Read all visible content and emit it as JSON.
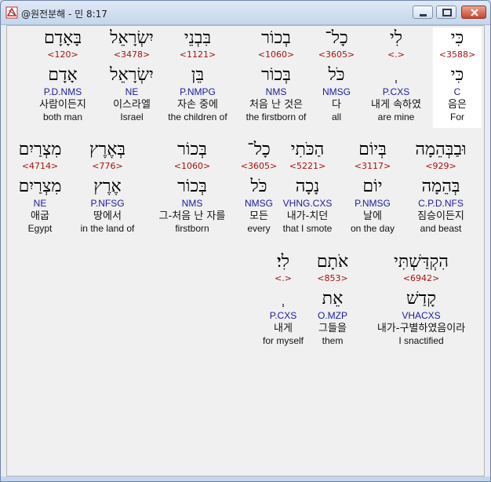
{
  "window": {
    "title": "@원전분해 - 민 8:17",
    "buttons": {
      "minimize": "minimize-icon",
      "maximize": "maximize-icon",
      "close": "close-icon"
    }
  },
  "verse": {
    "rows": [
      {
        "words": [
          {
            "heb": "כִּי",
            "strong": "<3588>",
            "lemma": "כִּי",
            "parse": "C",
            "kor": "음은",
            "eng": "For",
            "selected": true
          },
          {
            "heb": "לִי",
            "strong": "<.>",
            "lemma": "ְ",
            "parse": "P.CXS",
            "kor": "내게 속하였",
            "eng": "are mine"
          },
          {
            "heb": "כָל־",
            "strong": "<3605>",
            "lemma": "כֹּל",
            "parse": "NMSG",
            "kor": "다",
            "eng": "all"
          },
          {
            "heb": "בְכוֹר",
            "strong": "<1060>",
            "lemma": "בְּכוֹר",
            "parse": "NMS",
            "kor": "처음 난 것은",
            "eng": "the firstborn of"
          },
          {
            "heb": "בִּבְנֵי",
            "strong": "<1121>",
            "lemma": "בֵּן",
            "parse": "P.NMPG",
            "kor": "자손 중에",
            "eng": "the children of"
          },
          {
            "heb": "יִשְׂרָאֵל",
            "strong": "<3478>",
            "lemma": "יִשְׂרָאֵל",
            "parse": "NE",
            "kor": "이스라엘",
            "eng": "Israel"
          },
          {
            "heb": "בָּאָדָם",
            "strong": "<120>",
            "lemma": "אָדָם",
            "parse": "P.D.NMS",
            "kor": "사람이든지",
            "eng": "both man"
          }
        ]
      },
      {
        "words": [
          {
            "heb": "וּבַבְּהֵמָה",
            "strong": "<929>",
            "lemma": "בְּהֵמָה",
            "parse": "C.P.D.NFS",
            "kor": "짐승이든지",
            "eng": "and beast"
          },
          {
            "heb": "בְּיוֹם",
            "strong": "<3117>",
            "lemma": "יוֹם",
            "parse": "P.NMSG",
            "kor": "날에",
            "eng": "on the day"
          },
          {
            "heb": "הַכֹּתִי",
            "strong": "<5221>",
            "lemma": "נָכָה",
            "parse": "VHNG.CXS",
            "kor": "내가-치던",
            "eng": "that I smote"
          },
          {
            "heb": "כָל־",
            "strong": "<3605>",
            "lemma": "כֹּל",
            "parse": "NMSG",
            "kor": "모든",
            "eng": "every"
          },
          {
            "heb": "בְּכוֹר",
            "strong": "<1060>",
            "lemma": "בְּכוֹר",
            "parse": "NMS",
            "kor": "그-처음 난 자를",
            "eng": "firstborn"
          },
          {
            "heb": "בְּאֶרֶץ",
            "strong": "<776>",
            "lemma": "אֶרֶץ",
            "parse": "P.NFSG",
            "kor": "땅에서",
            "eng": "in the land of"
          },
          {
            "heb": "מִצְרַיִם",
            "strong": "<4714>",
            "lemma": "מִצְרַיִם",
            "parse": "NE",
            "kor": "애굽",
            "eng": "Egypt"
          }
        ]
      },
      {
        "words": [
          {
            "heb": "הִקְדַּשְׁתִּי",
            "strong": "<6942>",
            "lemma": "קָדַשׁ",
            "parse": "VHACXS",
            "kor": "내가-구별하였음이라",
            "eng": "I snactified"
          },
          {
            "heb": "אֹתָם",
            "strong": "<853>",
            "lemma": "אֵת",
            "parse": "O.MZP",
            "kor": "그들을",
            "eng": "them"
          },
          {
            "heb": "לִי׃",
            "strong": "<.>",
            "lemma": "ְ",
            "parse": "P.CXS",
            "kor": "내게",
            "eng": "for myself"
          }
        ]
      }
    ]
  }
}
